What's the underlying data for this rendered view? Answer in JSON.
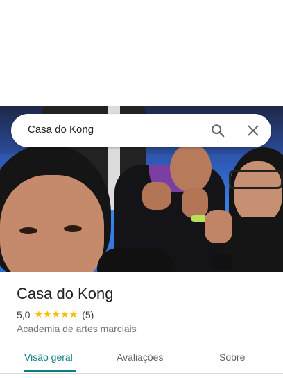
{
  "search": {
    "query": "Casa do Kong"
  },
  "place": {
    "name": "Casa do Kong",
    "rating": "5,0",
    "stars": "★★★★★",
    "review_count": "(5)",
    "category": "Academia de artes marciais"
  },
  "tabs": [
    {
      "label": "Visão geral",
      "active": true
    },
    {
      "label": "Avaliações",
      "active": false
    },
    {
      "label": "Sobre",
      "active": false
    }
  ],
  "colors": {
    "accent": "#0b7d86",
    "star": "#fbbc04"
  },
  "icons": [
    "search-icon",
    "close-icon"
  ]
}
